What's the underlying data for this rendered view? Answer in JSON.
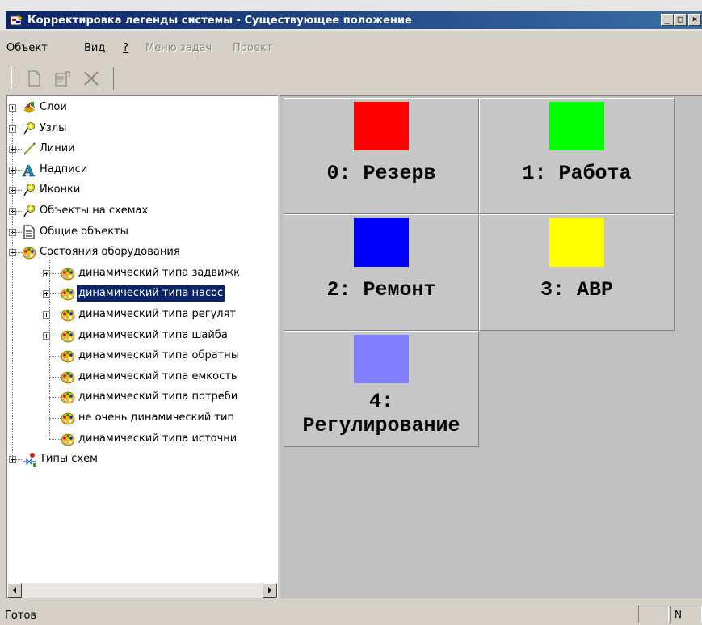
{
  "window": {
    "title": "Корректировка легенды системы - Существующее положение",
    "minimize": "_",
    "maximize": "□",
    "close": "×"
  },
  "menu": {
    "items": [
      {
        "label": "Объект",
        "enabled": true
      },
      {
        "label": "Вид",
        "enabled": true
      },
      {
        "label": "?",
        "enabled": true
      },
      {
        "label": "Меню задач",
        "enabled": false
      },
      {
        "label": "Проект",
        "enabled": false
      }
    ]
  },
  "toolbar": {
    "buttons": [
      {
        "icon": "new-document-icon",
        "enabled": false
      },
      {
        "icon": "properties-icon",
        "enabled": false
      },
      {
        "icon": "delete-icon",
        "enabled": false
      }
    ]
  },
  "tree": {
    "nodes": [
      {
        "label": "Слои",
        "icon": "layers-icon",
        "level": 0,
        "expander": "plus"
      },
      {
        "label": "Узлы",
        "icon": "node-icon",
        "level": 0,
        "expander": "plus"
      },
      {
        "label": "Линии",
        "icon": "line-icon",
        "level": 0,
        "expander": "plus"
      },
      {
        "label": "Надписи",
        "icon": "text-label-icon",
        "level": 0,
        "expander": "plus"
      },
      {
        "label": "Иконки",
        "icon": "node-icon",
        "level": 0,
        "expander": "plus"
      },
      {
        "label": "Объекты на схемах",
        "icon": "node-icon",
        "level": 0,
        "expander": "plus"
      },
      {
        "label": "Общие объекты",
        "icon": "document-icon",
        "level": 0,
        "expander": "plus"
      },
      {
        "label": "Состояния оборудования",
        "icon": "palette-icon",
        "level": 0,
        "expander": "minus"
      },
      {
        "label": "динамический типа задвижк",
        "icon": "palette-icon",
        "level": 1,
        "expander": "plus"
      },
      {
        "label": "динамический типа насос",
        "icon": "palette-icon",
        "level": 1,
        "expander": "plus",
        "selected": true
      },
      {
        "label": "динамический типа регулят",
        "icon": "palette-icon",
        "level": 1,
        "expander": "plus"
      },
      {
        "label": "динамический типа шайба",
        "icon": "palette-icon",
        "level": 1,
        "expander": "plus"
      },
      {
        "label": "динамический типа обратны",
        "icon": "palette-icon",
        "level": 1,
        "expander": null
      },
      {
        "label": "динамический типа емкость",
        "icon": "palette-icon",
        "level": 1,
        "expander": null
      },
      {
        "label": "динамический типа потреби",
        "icon": "palette-icon",
        "level": 1,
        "expander": null
      },
      {
        "label": "не очень динамический тип",
        "icon": "palette-icon",
        "level": 1,
        "expander": null
      },
      {
        "label": "динамический типа источни",
        "icon": "palette-icon",
        "level": 1,
        "expander": null
      },
      {
        "label": "Типы схем",
        "icon": "schema-types-icon",
        "level": 0,
        "expander": "plus"
      }
    ]
  },
  "legend": {
    "items": [
      {
        "text": "0: Резерв",
        "color": "#ff0000"
      },
      {
        "text": "1: Работа",
        "color": "#00ff00"
      },
      {
        "text": "2: Ремонт",
        "color": "#0000ff"
      },
      {
        "text": "3: АВР",
        "color": "#ffff00"
      },
      {
        "text": "4:\nРегулирование",
        "color": "#8080ff"
      }
    ]
  },
  "status": {
    "text": "Готов",
    "pane_text": "N"
  }
}
